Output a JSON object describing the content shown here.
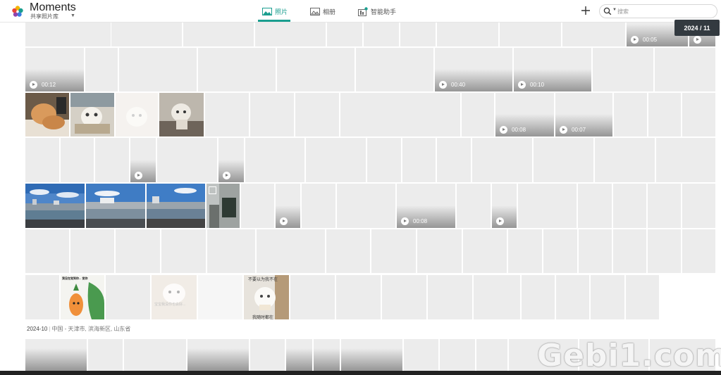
{
  "app": {
    "title": "Moments",
    "subtitle": "共享照片库"
  },
  "tabs": [
    {
      "label": "照片",
      "active": true
    },
    {
      "label": "相册",
      "active": false
    },
    {
      "label": "智能助手",
      "active": false
    }
  ],
  "search": {
    "placeholder": "搜索"
  },
  "timeline": {
    "current_date": "2024 / 11"
  },
  "videos": {
    "r1": "00:05",
    "r2a": "00:12",
    "r2b": "00:40",
    "r2c": "00:10",
    "r3a": "00:08",
    "r3b": "00:07",
    "r5": "00:08"
  },
  "section": {
    "date": "2024-10",
    "location": "中国 - 天津市, 滨海新区, 山东省"
  },
  "image_captions": {
    "sticker_top": "我没在觉到你... 觉你 ",
    "cat_meme_top": "不要以为我不在",
    "cat_meme_bottom": "我随时都在",
    "cat_faded": "宝宝我没你也会好..."
  },
  "watermark": "Gebi1.com",
  "colors": {
    "accent": "#1a9e8f",
    "badge_bg": "#333a40",
    "tile_placeholder": "#ececec"
  }
}
